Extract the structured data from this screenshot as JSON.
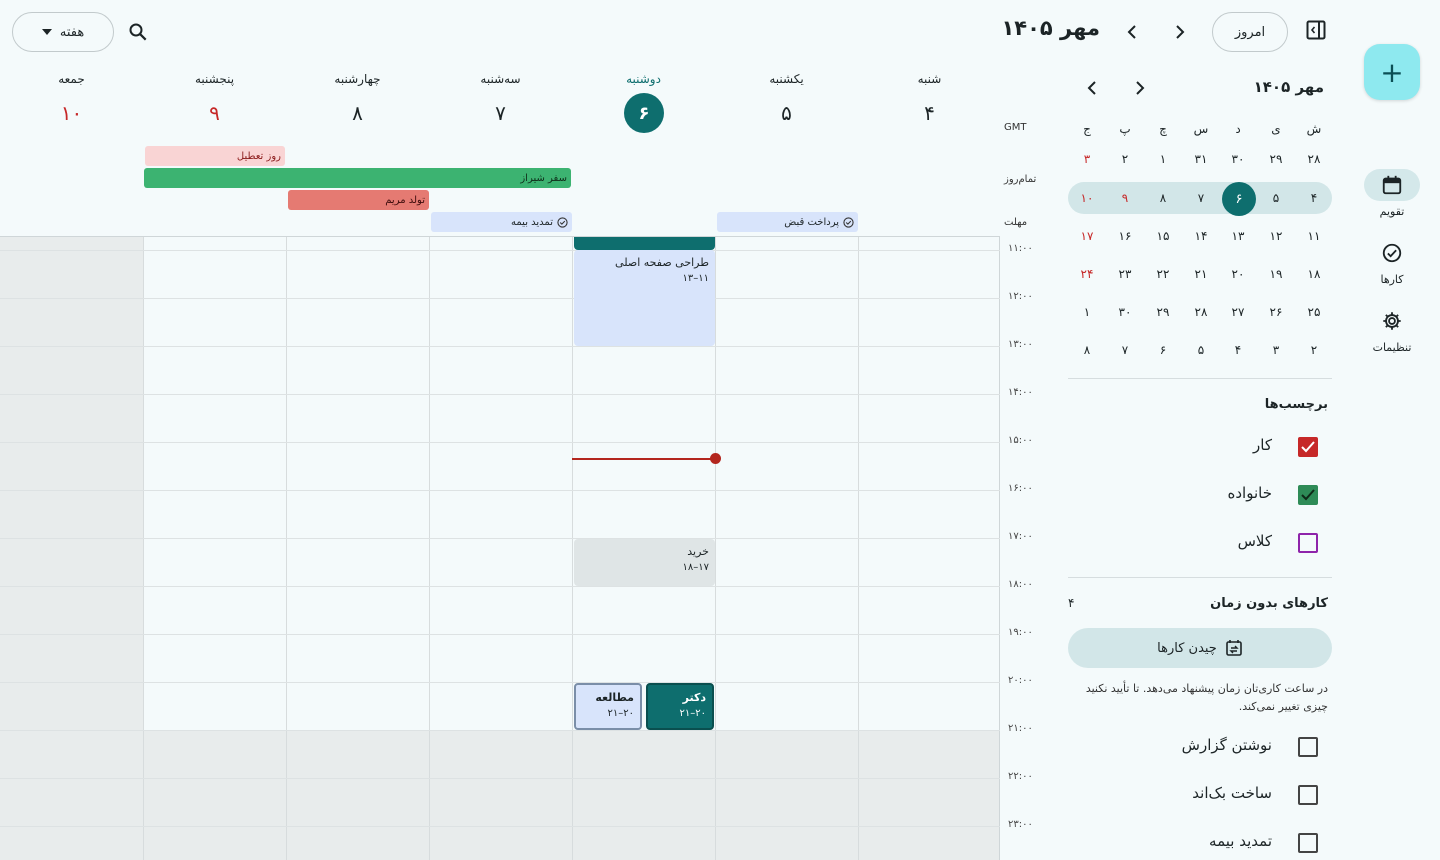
{
  "header": {
    "title": "مهر ۱۴۰۵",
    "today_label": "امروز",
    "view_label": "هفته"
  },
  "rail": {
    "items": [
      {
        "label": "تقویم",
        "icon": "calendar-icon"
      },
      {
        "label": "کارها",
        "icon": "task-check-icon"
      },
      {
        "label": "تنظیمات",
        "icon": "gear-icon"
      }
    ]
  },
  "mini_calendar": {
    "title": "مهر ۱۴۰۵",
    "weekdays": [
      "ش",
      "ی",
      "د",
      "س",
      "چ",
      "پ",
      "ج"
    ],
    "weeks": [
      [
        "۲۸",
        "۲۹",
        "۳۰",
        "۳۱",
        "۱",
        "۲",
        "۳"
      ],
      [
        "۴",
        "۵",
        "۶",
        "۷",
        "۸",
        "۹",
        "۱۰"
      ],
      [
        "۱۱",
        "۱۲",
        "۱۳",
        "۱۴",
        "۱۵",
        "۱۶",
        "۱۷"
      ],
      [
        "۱۸",
        "۱۹",
        "۲۰",
        "۲۱",
        "۲۲",
        "۲۳",
        "۲۴"
      ],
      [
        "۲۵",
        "۲۶",
        "۲۷",
        "۲۸",
        "۲۹",
        "۳۰",
        "۱"
      ],
      [
        "۲",
        "۳",
        "۴",
        "۵",
        "۶",
        "۷",
        "۸"
      ]
    ]
  },
  "labels_section": {
    "title": "برچسب‌ها",
    "items": [
      {
        "label": "کار",
        "checked": true,
        "color": "#c62828"
      },
      {
        "label": "خانواده",
        "checked": true,
        "color": "#2e8b57"
      },
      {
        "label": "کلاس",
        "checked": false,
        "color": "#8e24aa"
      }
    ]
  },
  "unscheduled": {
    "title": "کارهای بدون زمان",
    "count": "۴",
    "arrange_label": "چیدن کارها",
    "hint": "در ساعت کاری‌تان زمان پیشنهاد می‌دهد. تا تأیید نکنید چیزی تغییر نمی‌کند.",
    "tasks": [
      "نوشتن گزارش",
      "ساخت بک‌اند",
      "تمدید بیمه"
    ]
  },
  "week": {
    "days": [
      {
        "name": "شنبه",
        "num": "۴"
      },
      {
        "name": "یکشنبه",
        "num": "۵"
      },
      {
        "name": "دوشنبه",
        "num": "۶"
      },
      {
        "name": "سه‌شنبه",
        "num": "۷"
      },
      {
        "name": "چهارشنبه",
        "num": "۸"
      },
      {
        "name": "پنجشنبه",
        "num": "۹"
      },
      {
        "name": "جمعه",
        "num": "۱۰"
      }
    ],
    "gmt_label": "GMT",
    "allday_label": "تمام‌روز",
    "deadline_label": "مهلت",
    "allday_events": [
      {
        "title": "روز تعطیل",
        "color": "#f9d4d4",
        "text_color": "#8b1a1a"
      },
      {
        "title": "سفر شیراز",
        "color": "#3cb371",
        "text_color": "#0f2d1a"
      },
      {
        "title": "تولد مریم",
        "color": "#e57a72",
        "text_color": "#3d0c0c"
      }
    ],
    "deadlines": [
      {
        "title": "پرداخت قبض"
      },
      {
        "title": "تمدید بیمه"
      }
    ],
    "hours": [
      "۱۱:۰۰",
      "۱۲:۰۰",
      "۱۳:۰۰",
      "۱۴:۰۰",
      "۱۵:۰۰",
      "۱۶:۰۰",
      "۱۷:۰۰",
      "۱۸:۰۰",
      "۱۹:۰۰",
      "۲۰:۰۰",
      "۲۱:۰۰",
      "۲۲:۰۰",
      "۲۳:۰۰"
    ],
    "events": [
      {
        "title": "طراحی صفحه اصلی",
        "time": "۱۱–۱۳"
      },
      {
        "title": "خرید",
        "time": "۱۷–۱۸"
      },
      {
        "title": "دکتر",
        "time": "۲۰–۲۱"
      },
      {
        "title": "مطالعه",
        "time": "۲۰–۲۱"
      }
    ]
  }
}
